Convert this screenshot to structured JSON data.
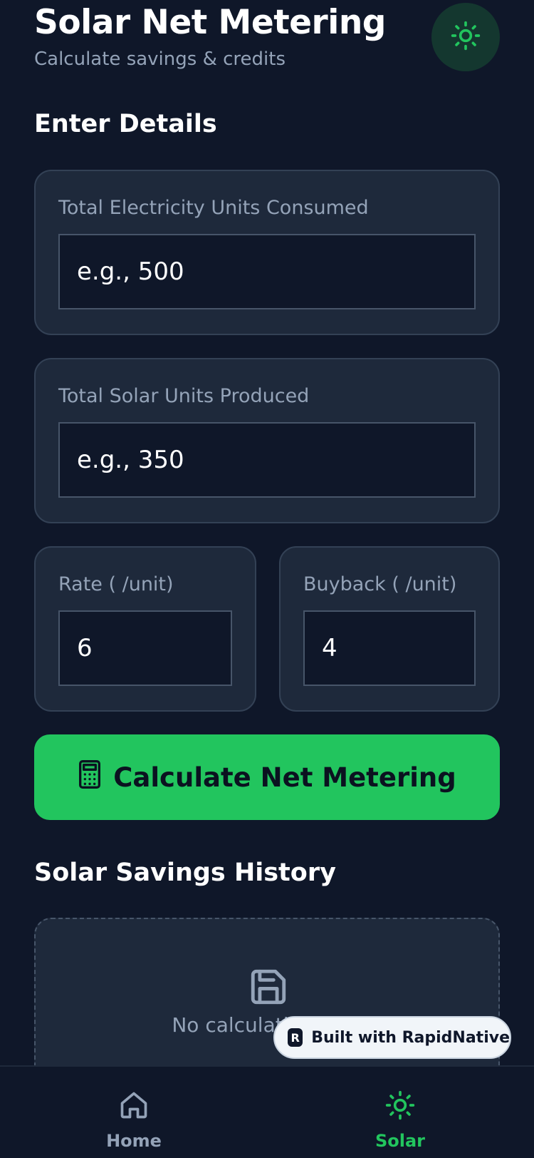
{
  "header": {
    "title": "Solar Net Metering",
    "subtitle": "Calculate savings & credits",
    "theme_icon": "sun-icon"
  },
  "details": {
    "section_title": "Enter Details",
    "electricity": {
      "label": "Total Electricity Units Consumed",
      "placeholder": "e.g., 500"
    },
    "solar": {
      "label": "Total Solar Units Produced",
      "placeholder": "e.g., 350"
    },
    "rate": {
      "label": "Rate (   /unit)",
      "value": "6"
    },
    "buyback": {
      "label": "Buyback (   /unit)",
      "value": "4"
    }
  },
  "calculate_button": {
    "label": "Calculate Net Metering",
    "icon": "calculator-icon"
  },
  "history": {
    "section_title": "Solar Savings History",
    "empty_text": "No calculations yet",
    "icon": "save-icon"
  },
  "badge": {
    "label": "Built with RapidNative",
    "logo": "R"
  },
  "nav": {
    "items": [
      {
        "label": "Home",
        "icon": "home-icon",
        "active": false
      },
      {
        "label": "Solar",
        "icon": "sun-icon",
        "active": true
      }
    ]
  },
  "colors": {
    "background": "#0f1729",
    "card": "#1e293b",
    "accent": "#22c55e",
    "muted_text": "#94a3b8"
  }
}
